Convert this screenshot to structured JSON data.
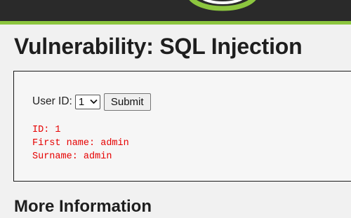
{
  "header": {
    "logo_icon": "dvwa-logo-swoosh",
    "accent_color": "#8cc63f",
    "background_color": "#2a2a2a"
  },
  "page": {
    "title": "Vulnerability: SQL Injection"
  },
  "form": {
    "user_id_label": "User ID:",
    "selected_value": "1",
    "submit_label": "Submit"
  },
  "result": {
    "lines": [
      "ID: 1",
      "First name: admin",
      "Surname: admin"
    ],
    "color": "#e60000"
  },
  "more_info": {
    "heading": "More Information"
  }
}
